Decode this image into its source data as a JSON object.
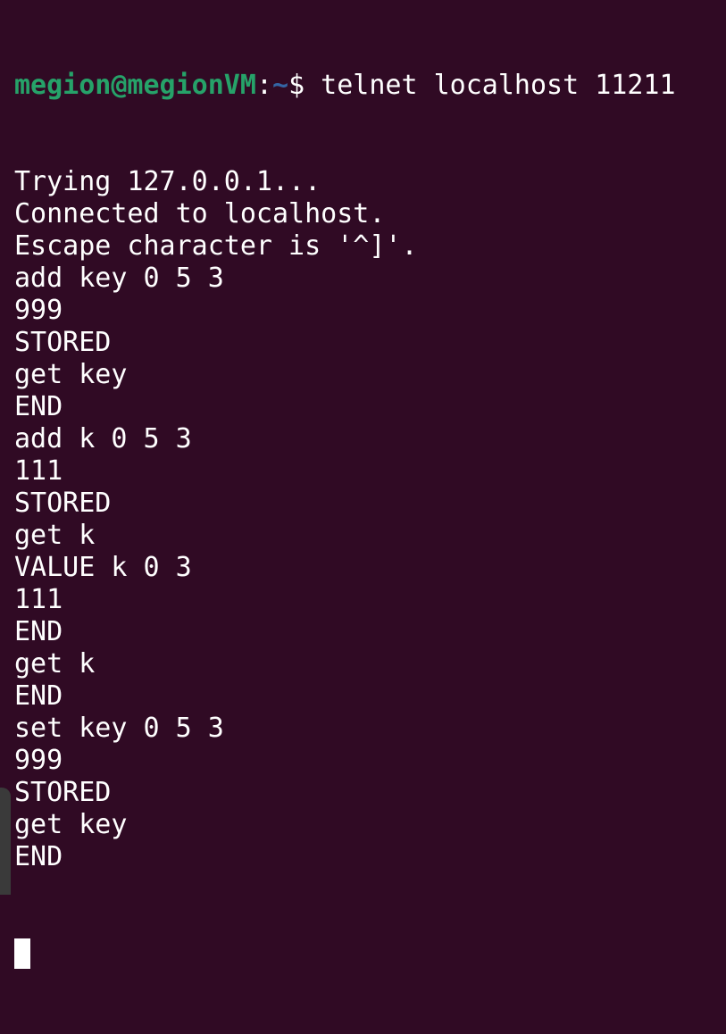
{
  "prompt": {
    "user_host": "megion@megionVM",
    "colon": ":",
    "path": "~",
    "dollar": "$",
    "command": " telnet localhost 11211"
  },
  "output_lines": [
    "Trying 127.0.0.1...",
    "Connected to localhost.",
    "Escape character is '^]'.",
    "add key 0 5 3",
    "999",
    "STORED",
    "get key",
    "END",
    "add k 0 5 3",
    "111",
    "STORED",
    "get k",
    "VALUE k 0 3",
    "111",
    "END",
    "get k",
    "END",
    "set key 0 5 3",
    "999",
    "STORED",
    "get key",
    "END"
  ],
  "colors": {
    "background": "#300a24",
    "text": "#ffffff",
    "prompt_user": "#26a269",
    "prompt_path": "#3465a4"
  }
}
